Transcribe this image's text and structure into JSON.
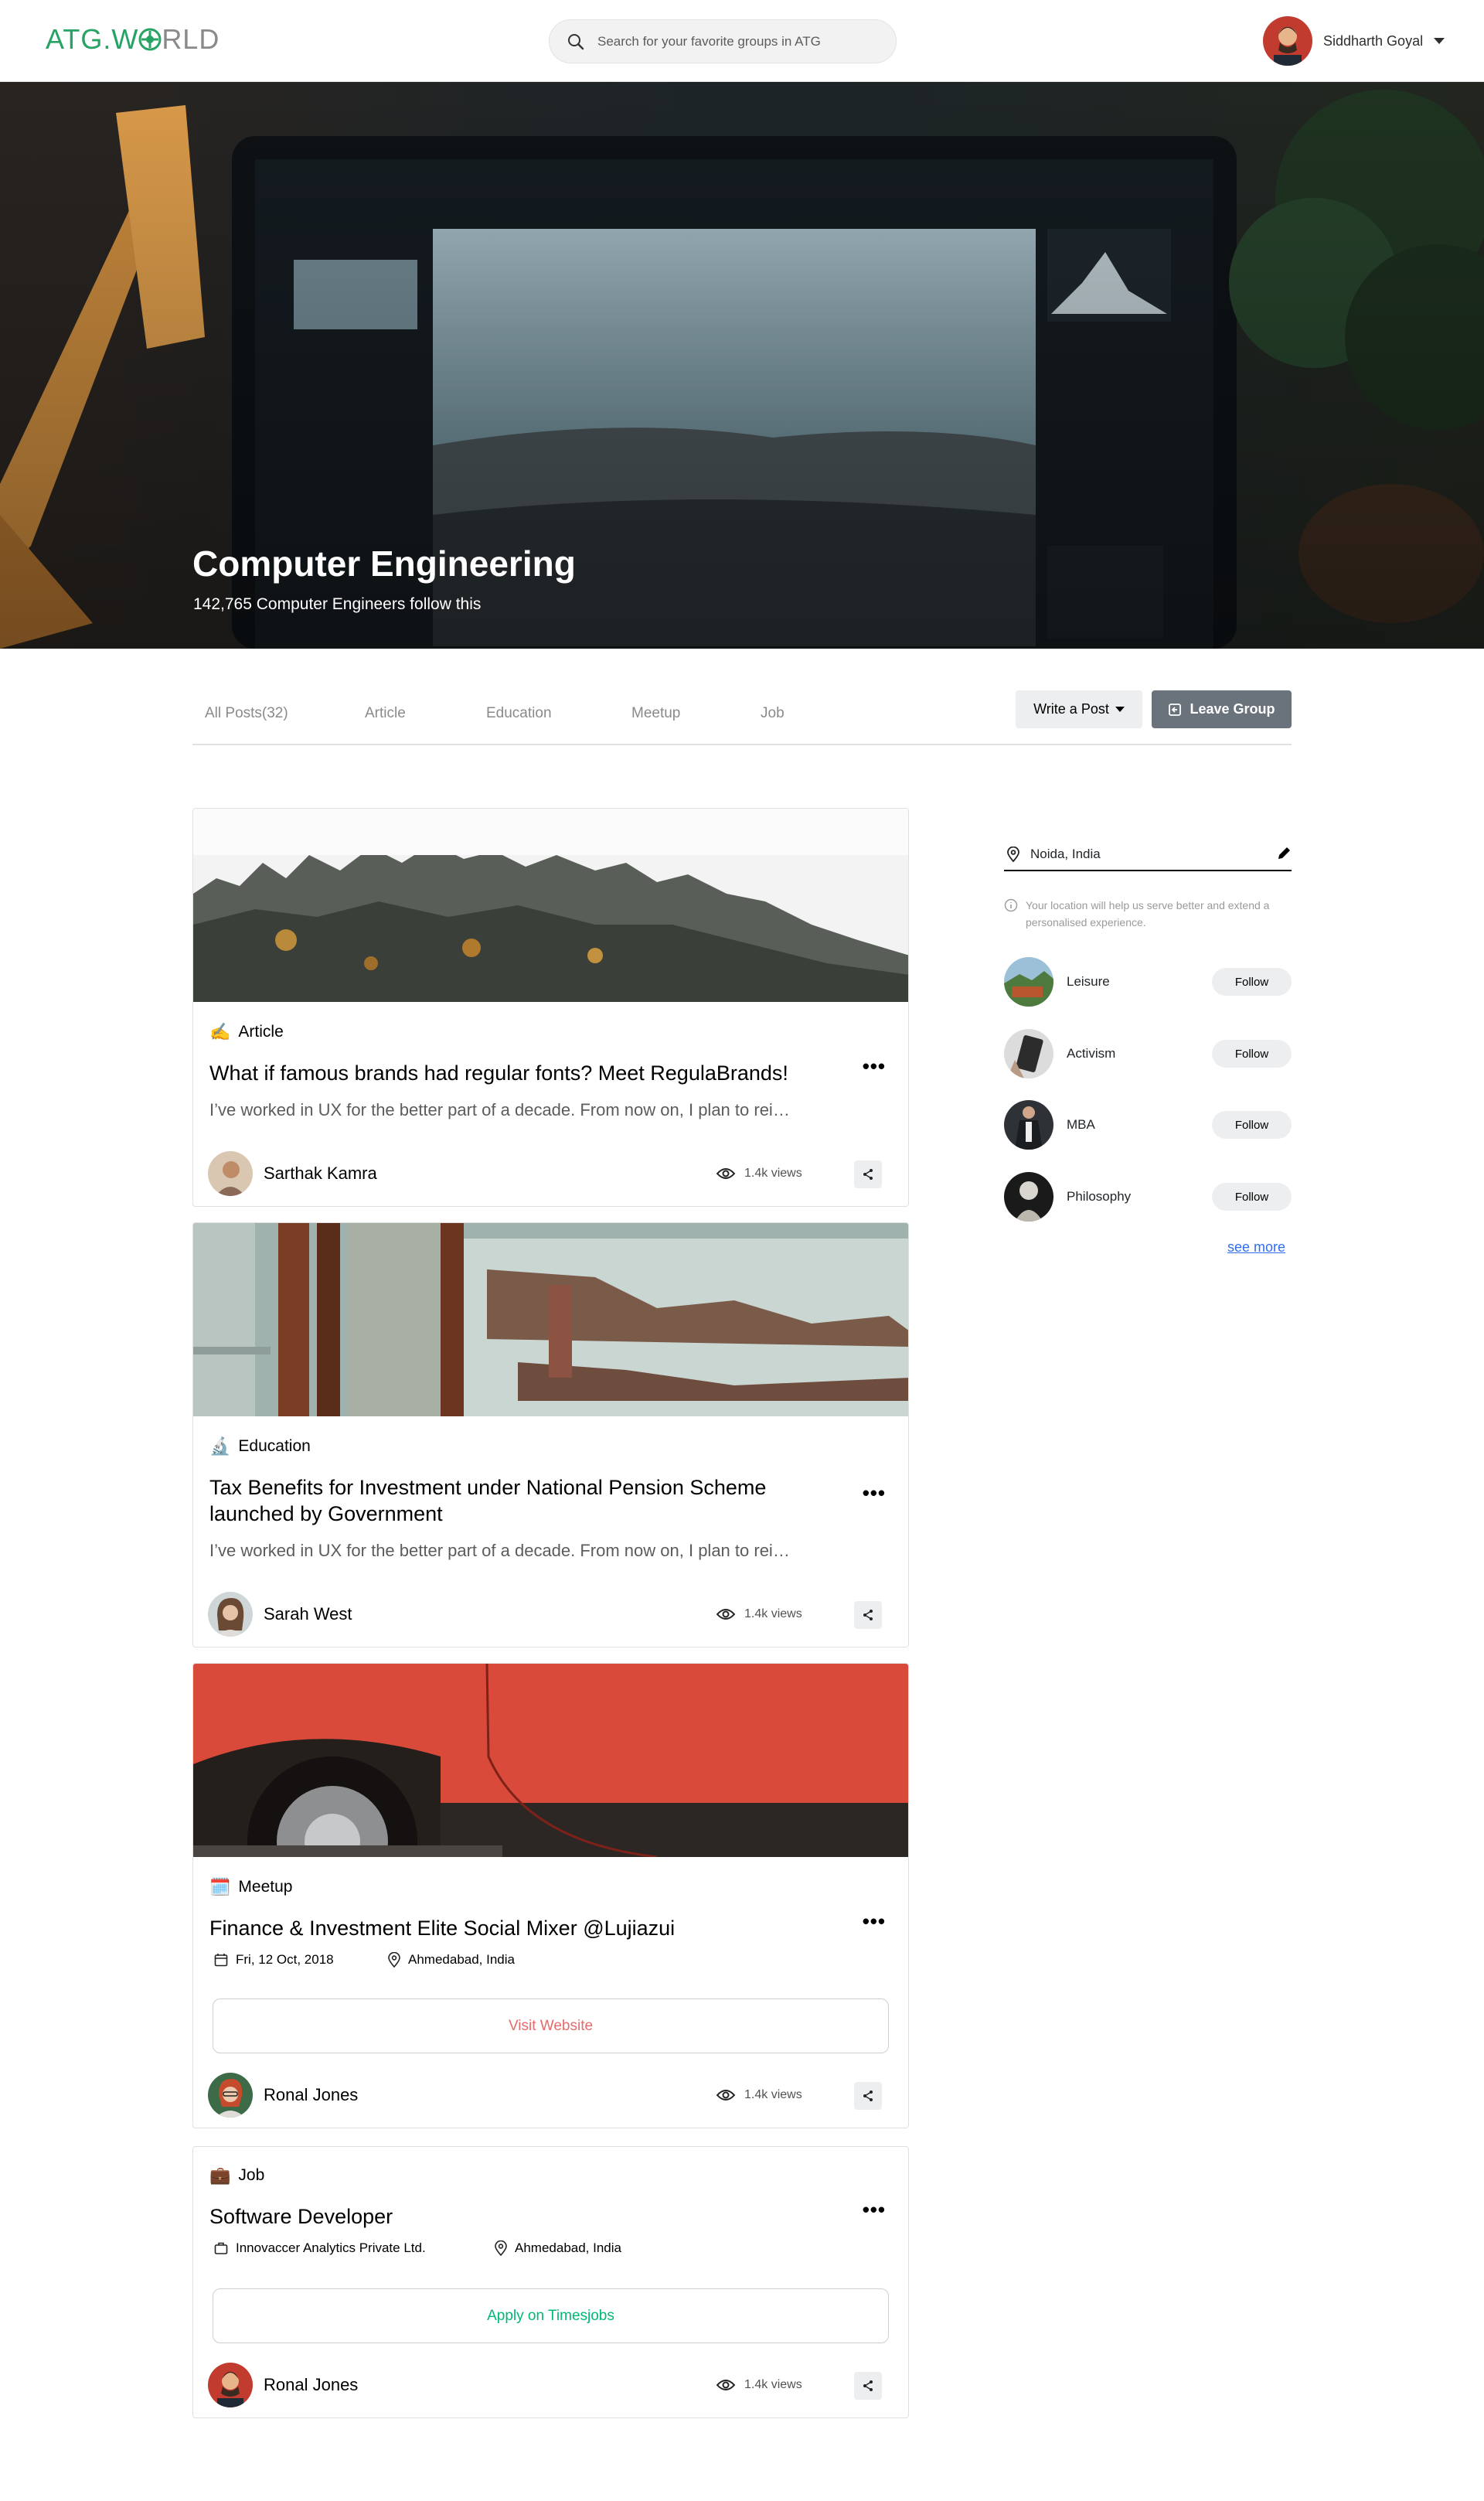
{
  "header": {
    "logo_prefix": "ATG.W",
    "logo_suffix": "RLD",
    "search_placeholder": "Search for your favorite groups in ATG",
    "user_name": "Siddharth Goyal"
  },
  "hero": {
    "title": "Computer Engineering",
    "subtitle": "142,765 Computer Engineers follow this"
  },
  "tabs": {
    "items": [
      "All Posts(32)",
      "Article",
      "Education",
      "Meetup",
      "Job"
    ],
    "write_post": "Write a Post",
    "leave_group": "Leave Group"
  },
  "posts": [
    {
      "type": "Article",
      "type_icon": "✍️",
      "title": "What if famous brands had regular fonts? Meet RegulaBrands!",
      "excerpt": "I’ve worked in UX for the better part of a decade. From now on, I plan to rei…",
      "author": "Sarthak Kamra",
      "views": "1.4k views"
    },
    {
      "type": "Education",
      "type_icon": "🔬",
      "title": "Tax Benefits for Investment under National Pension Scheme launched by Government",
      "excerpt": "I’ve worked in UX for the better part of a decade. From now on, I plan to rei…",
      "author": "Sarah West",
      "views": "1.4k views"
    },
    {
      "type": "Meetup",
      "type_icon": "🗓️",
      "title": "Finance & Investment Elite Social Mixer @Lujiazui",
      "date": "Fri, 12 Oct, 2018",
      "location": "Ahmedabad, India",
      "button": "Visit Website",
      "button_color": "#e56c6c",
      "author": "Ronal Jones",
      "views": "1.4k views"
    },
    {
      "type": "Job",
      "type_icon": "💼",
      "title": "Software Developer",
      "company": "Innovaccer Analytics Private Ltd.",
      "location": "Ahmedabad, India",
      "button": "Apply on Timesjobs",
      "button_color": "#02b875",
      "author": "Ronal Jones",
      "views": "1.4k views"
    }
  ],
  "sidebar": {
    "location": "Noida, India",
    "note": "Your location will help us serve better and extend a personalised experience.",
    "groups": [
      {
        "name": "Leisure",
        "action": "Follow"
      },
      {
        "name": "Activism",
        "action": "Follow"
      },
      {
        "name": "MBA",
        "action": "Follow"
      },
      {
        "name": "Philosophy",
        "action": "Follow"
      }
    ],
    "see_more": "see more"
  },
  "colors": {
    "brand": "#27a365",
    "link": "#2f6fed",
    "leave_btn": "#6a737c"
  },
  "icons": [
    "search-icon",
    "caret-down-icon",
    "leave-icon",
    "more-icon",
    "eye-icon",
    "share-icon",
    "calendar-icon",
    "location-icon",
    "briefcase-icon",
    "pin-icon",
    "pencil-icon",
    "info-icon"
  ]
}
